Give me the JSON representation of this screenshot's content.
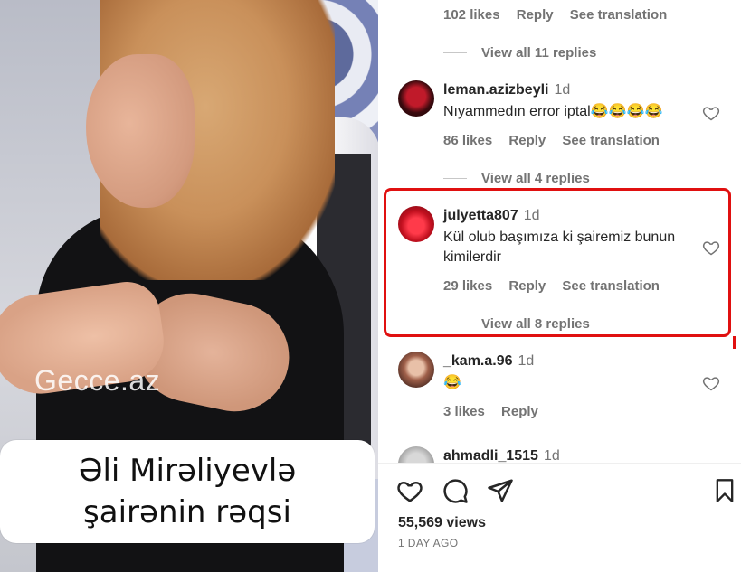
{
  "video": {
    "watermark": "Gecce.az",
    "caption": "Əli Mirəliyevlə şairənin rəqsi"
  },
  "comments_top": {
    "partial_meta": [
      "102 likes",
      "Reply",
      "See translation"
    ],
    "view_replies": "View all 11 replies"
  },
  "comments": [
    {
      "username": "leman.azizbeyli",
      "time": "1d",
      "text": "Nıyammedın error iptal😂😂😂😂",
      "likes": "86 likes",
      "reply": "Reply",
      "translate": "See translation",
      "view_replies": "View all 4 replies"
    },
    {
      "username": "julyetta807",
      "time": "1d",
      "text": "Kül olub başımıza ki şairemiz bunun kimilerdir",
      "likes": "29 likes",
      "reply": "Reply",
      "translate": "See translation",
      "view_replies": "View all 8 replies"
    },
    {
      "username": "_kam.a.96",
      "time": "1d",
      "text": "😂",
      "likes": "3 likes",
      "reply": "Reply"
    },
    {
      "username": "ahmadli_1515",
      "time": "1d"
    }
  ],
  "icons": [
    "heart-icon",
    "comment-icon",
    "share-icon",
    "bookmark-icon"
  ],
  "post": {
    "views": "55,569 views",
    "posted": "1 DAY AGO"
  },
  "colors": {
    "highlight": "#e01010",
    "secondary_text": "#737373",
    "primary_text": "#262626"
  }
}
